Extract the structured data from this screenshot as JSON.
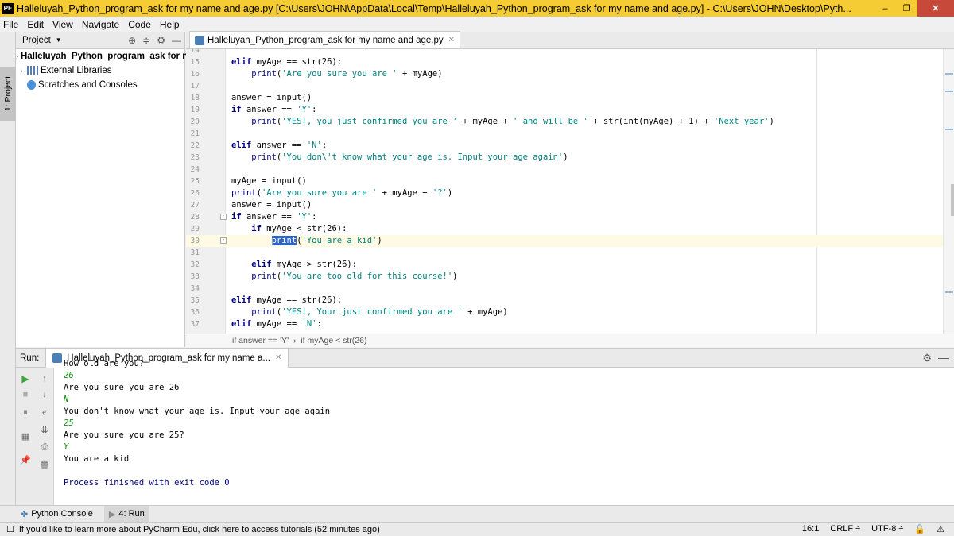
{
  "window": {
    "app_icon": "PE",
    "title": "Halleluyah_Python_program_ask for my name and age.py [C:\\Users\\JOHN\\AppData\\Local\\Temp\\Halleluyah_Python_program_ask for my name and age.py] - C:\\Users\\JOHN\\Desktop\\Pyth...",
    "minimize": "–",
    "maximize": "❐",
    "close": "✕",
    "accent": "#f5cc33"
  },
  "menu": [
    "File",
    "Edit",
    "View",
    "Navigate",
    "Code",
    "Help"
  ],
  "left_strip": {
    "tab": "1: Project"
  },
  "project": {
    "header": "Project",
    "items": [
      {
        "label": "Halleluyah_Python_program_ask for n",
        "icon": "folder-icon",
        "expand": "›"
      },
      {
        "label": "External Libraries",
        "icon": "library-icon",
        "expand": "›"
      },
      {
        "label": "Scratches and Consoles",
        "icon": "scratches-icon",
        "expand": ""
      }
    ]
  },
  "editor": {
    "tab": "Halleluyah_Python_program_ask for my name and age.py",
    "breadcrumb": [
      "if answer == 'Y'",
      "if myAge < str(26)"
    ],
    "lines": [
      {
        "n": "14",
        "html": ""
      },
      {
        "n": "15",
        "html": "<span class=\"kw\">elif</span> myAge == str(26):"
      },
      {
        "n": "16",
        "html": "    <span class=\"fn\">print</span>(<span class=\"str\">'Are you sure you are '</span> + myAge)"
      },
      {
        "n": "17",
        "html": ""
      },
      {
        "n": "18",
        "html": "answer = input()"
      },
      {
        "n": "19",
        "html": "<span class=\"kw\">if</span> answer == <span class=\"str\">'Y'</span>:"
      },
      {
        "n": "20",
        "html": "    <span class=\"fn\">print</span>(<span class=\"str\">'YES!, you just confirmed you are '</span> + myAge + <span class=\"str\">' and will be '</span> + str(int(myAge) + 1) + <span class=\"str\">'Next year'</span>)"
      },
      {
        "n": "21",
        "html": ""
      },
      {
        "n": "22",
        "html": "<span class=\"kw\">elif</span> answer == <span class=\"str\">'N'</span>:"
      },
      {
        "n": "23",
        "html": "    <span class=\"fn\">print</span>(<span class=\"str\">'You don\\'t know what your age is. Input your age again'</span>)"
      },
      {
        "n": "24",
        "html": ""
      },
      {
        "n": "25",
        "html": "myAge = input()"
      },
      {
        "n": "26",
        "html": "<span class=\"fn\">print</span>(<span class=\"str\">'Are you sure you are '</span> + myAge + <span class=\"str\">'?'</span>)"
      },
      {
        "n": "27",
        "html": "answer = input()"
      },
      {
        "n": "28",
        "html": "<span class=\"kw\">if</span> answer == <span class=\"str\">'Y'</span>:"
      },
      {
        "n": "29",
        "html": "    <span class=\"kw\">if</span> myAge &lt; str(26):"
      },
      {
        "n": "30",
        "html": "        <span class=\"sel\">print</span>(<span class=\"str\">'You are a kid'</span>)",
        "current": true
      },
      {
        "n": "31",
        "html": ""
      },
      {
        "n": "32",
        "html": "    <span class=\"kw\">elif</span> myAge &gt; str(26):"
      },
      {
        "n": "33",
        "html": "    <span class=\"fn\">print</span>(<span class=\"str\">'You are too old for this course!'</span>)"
      },
      {
        "n": "34",
        "html": ""
      },
      {
        "n": "35",
        "html": "<span class=\"kw\">elif</span> myAge == str(26):"
      },
      {
        "n": "36",
        "html": "    <span class=\"fn\">print</span>(<span class=\"str\">'YES!, Your just confirmed you are '</span> + myAge)"
      },
      {
        "n": "37",
        "html": "<span class=\"kw\">elif</span> myAge == <span class=\"str\">'N'</span>:"
      }
    ]
  },
  "run": {
    "label": "Run:",
    "tab": "Halleluyah_Python_program_ask for my name a...",
    "output": [
      {
        "text": "How old are you?",
        "kind": "out"
      },
      {
        "text": "26",
        "kind": "in"
      },
      {
        "text": "Are you sure you are 26",
        "kind": "out"
      },
      {
        "text": "N",
        "kind": "in"
      },
      {
        "text": "You don't know what your age is. Input your age again",
        "kind": "out"
      },
      {
        "text": "25",
        "kind": "in"
      },
      {
        "text": "Are you sure you are 25?",
        "kind": "out"
      },
      {
        "text": "Y",
        "kind": "in"
      },
      {
        "text": "You are a kid",
        "kind": "out"
      },
      {
        "text": "",
        "kind": "out"
      },
      {
        "text": "Process finished with exit code 0",
        "kind": "exit"
      }
    ]
  },
  "bottom_tabs": [
    {
      "label": "Python Console",
      "icon": "python-console-icon"
    },
    {
      "label": "4: Run",
      "icon": "run-icon",
      "active": true
    }
  ],
  "status": {
    "message": "If you'd like to learn more about PyCharm Edu, click here to access tutorials (52 minutes ago)",
    "position": "16:1",
    "line_sep": "CRLF ÷",
    "encoding": "UTF-8 ÷"
  }
}
